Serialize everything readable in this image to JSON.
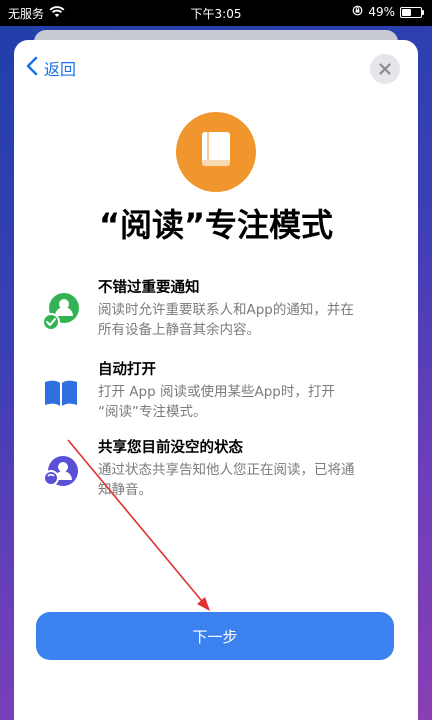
{
  "status_bar": {
    "carrier": "无服务",
    "time": "下午3:05",
    "battery_percent": "49%",
    "battery_level": 0.49
  },
  "header": {
    "back_label": "返回",
    "back_icon": "chevron-left-icon",
    "close_icon": "close-icon"
  },
  "hero": {
    "icon": "book-icon",
    "title": "“阅读”专注模式",
    "accent_color": "#f0962c"
  },
  "features": [
    {
      "icon": "contact-check-icon",
      "title": "不错过重要通知",
      "desc_line1": "阅读时允许重要联系人和App的通知，并在",
      "desc_line2": "所有设备上静音其余内容。"
    },
    {
      "icon": "open-book-icon",
      "title": "自动打开",
      "desc_line1": "打开 App 阅读或使用某些App时，打开",
      "desc_line2": "“阅读”专注模式。"
    },
    {
      "icon": "share-status-icon",
      "title": "共享您目前没空的状态",
      "desc_line1": "通过状态共享告知他人您正在阅读，已将通",
      "desc_line2": "知静音。"
    }
  ],
  "footer": {
    "next_label": "下一步",
    "button_color": "#3b82f0"
  }
}
